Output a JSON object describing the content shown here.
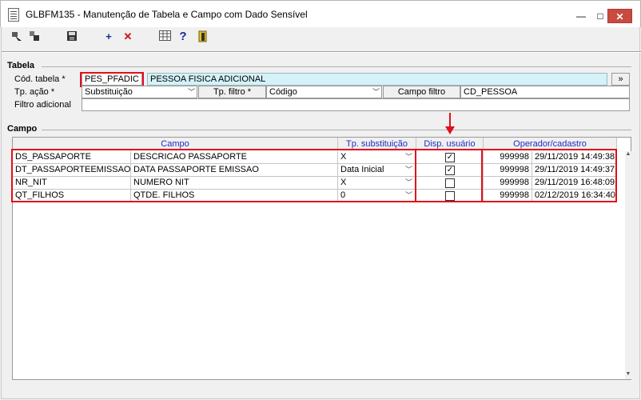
{
  "window": {
    "title": "GLBFM135 - Manutenção de Tabela e Campo com Dado Sensível",
    "minimize": "—",
    "maximize": "□",
    "close": "✕"
  },
  "toolbar": {
    "icons": [
      "first-icon",
      "prev-icon",
      "save-icon",
      "add-icon",
      "delete-icon",
      "table-icon",
      "help-icon",
      "exit-icon"
    ],
    "add_glyph": "+",
    "delete_glyph": "✕",
    "help_glyph": "?"
  },
  "tabela": {
    "group_label": "Tabela",
    "cod_label": "Cód. tabela *",
    "cod_value": "PES_PFADIC",
    "desc_value": "PESSOA FISICA ADICIONAL",
    "lookup_button": "»",
    "tp_acao_label": "Tp. ação *",
    "tp_acao_value": "Substituição",
    "tp_filtro_label": "Tp. filtro *",
    "tp_filtro_value": "Código",
    "campo_filtro_label": "Campo filtro",
    "campo_filtro_value": "CD_PESSOA",
    "filtro_adicional_label": "Filtro adicional",
    "filtro_adicional_value": ""
  },
  "campo": {
    "group_label": "Campo",
    "headers": {
      "campo": "Campo",
      "tp_substituicao": "Tp. substituição",
      "disp_usuario": "Disp. usuário",
      "operador_cadastro": "Operador/cadastro"
    },
    "rows": [
      {
        "code": "DS_PASSAPORTE",
        "desc": "DESCRICAO PASSAPORTE",
        "tp": "X",
        "disp": true,
        "operador": "999998",
        "data": "29/11/2019 14:49:38"
      },
      {
        "code": "DT_PASSAPORTEEMISSAO",
        "desc": "DATA PASSAPORTE EMISSAO",
        "tp": "Data Inicial",
        "disp": true,
        "operador": "999998",
        "data": "29/11/2019 14:49:37"
      },
      {
        "code": "NR_NIT",
        "desc": "NUMERO NIT",
        "tp": "X",
        "disp": false,
        "operador": "999998",
        "data": "29/11/2019 16:48:09"
      },
      {
        "code": "QT_FILHOS",
        "desc": "QTDE. FILHOS",
        "tp": "0",
        "disp": false,
        "operador": "999998",
        "data": "02/12/2019 16:34:40"
      }
    ]
  },
  "colors": {
    "highlight": "#e0101a",
    "header_text": "#1f2cbf",
    "cyan_field": "#d4f2f8"
  }
}
